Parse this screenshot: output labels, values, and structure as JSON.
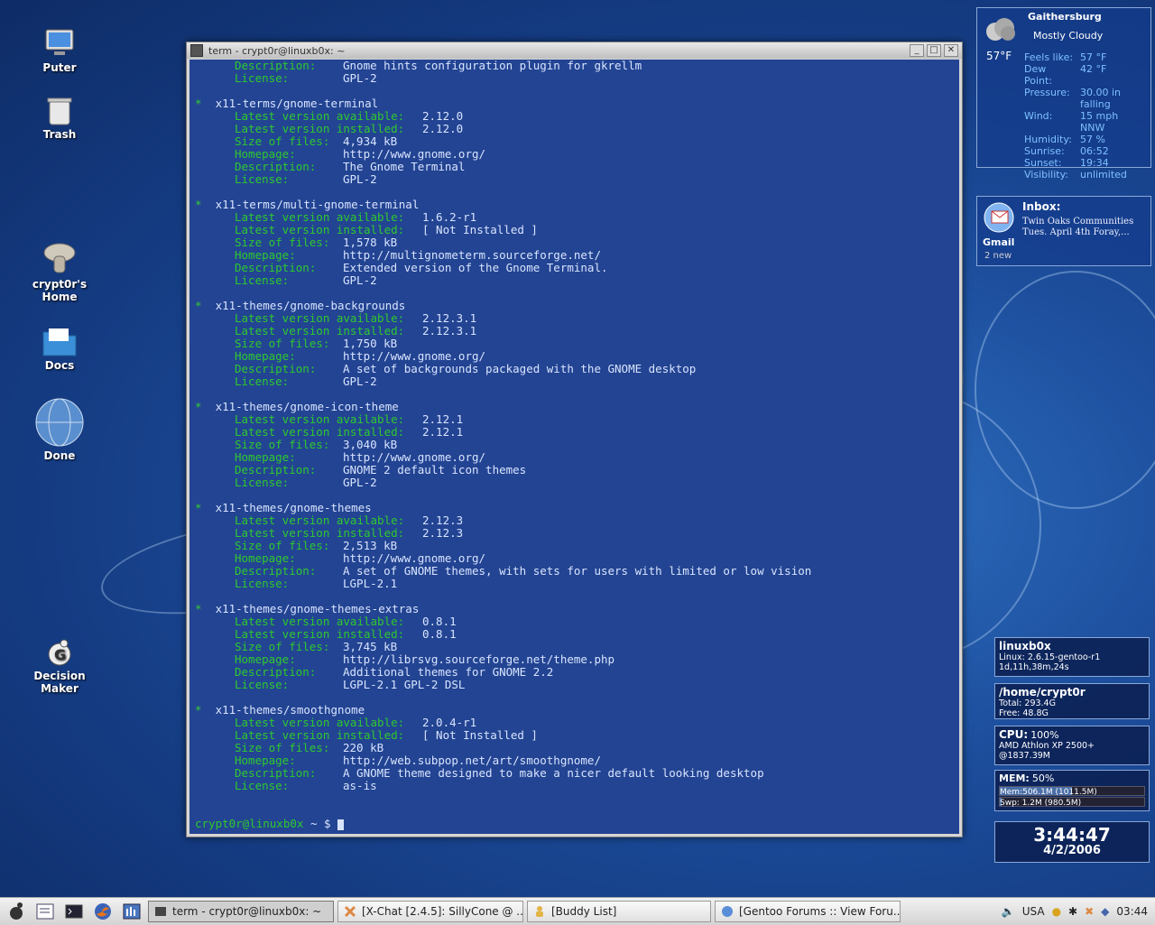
{
  "desktop": {
    "icons": [
      {
        "label": "Puter"
      },
      {
        "label": "Trash"
      },
      {
        "label": "crypt0r's Home"
      },
      {
        "label": "Docs"
      },
      {
        "label": "Done"
      },
      {
        "label": "Decision Maker"
      }
    ]
  },
  "terminal": {
    "title": "term - crypt0r@linuxb0x: ~",
    "top_lines": [
      {
        "key": "Description:",
        "value": "Gnome hints configuration plugin for gkrellm"
      },
      {
        "key": "License:",
        "value": "GPL-2"
      }
    ],
    "packages": [
      {
        "name": "x11-terms/gnome-terminal",
        "latest": "2.12.0",
        "installed": "2.12.0",
        "size": "4,934 kB",
        "homepage": "http://www.gnome.org/",
        "description": "The Gnome Terminal",
        "license": "GPL-2"
      },
      {
        "name": "x11-terms/multi-gnome-terminal",
        "latest": "1.6.2-r1",
        "installed": "[ Not Installed ]",
        "size": "1,578 kB",
        "homepage": "http://multignometerm.sourceforge.net/",
        "description": "Extended version of the Gnome Terminal.",
        "license": "GPL-2"
      },
      {
        "name": "x11-themes/gnome-backgrounds",
        "latest": "2.12.3.1",
        "installed": "2.12.3.1",
        "size": "1,750 kB",
        "homepage": "http://www.gnome.org/",
        "description": "A set of backgrounds packaged with the GNOME desktop",
        "license": "GPL-2"
      },
      {
        "name": "x11-themes/gnome-icon-theme",
        "latest": "2.12.1",
        "installed": "2.12.1",
        "size": "3,040 kB",
        "homepage": "http://www.gnome.org/",
        "description": "GNOME 2 default icon themes",
        "license": "GPL-2"
      },
      {
        "name": "x11-themes/gnome-themes",
        "latest": "2.12.3",
        "installed": "2.12.3",
        "size": "2,513 kB",
        "homepage": "http://www.gnome.org/",
        "description": "A set of GNOME themes, with sets for users with limited or low vision",
        "license": "LGPL-2.1"
      },
      {
        "name": "x11-themes/gnome-themes-extras",
        "latest": "0.8.1",
        "installed": "0.8.1",
        "size": "3,745 kB",
        "homepage": "http://librsvg.sourceforge.net/theme.php",
        "description": "Additional themes for GNOME 2.2",
        "license": "LGPL-2.1 GPL-2 DSL"
      },
      {
        "name": "x11-themes/smoothgnome",
        "latest": "2.0.4-r1",
        "installed": "[ Not Installed ]",
        "size": "220 kB",
        "homepage": "http://web.subpop.net/art/smoothgnome/",
        "description": "A GNOME theme designed to make a nicer default looking desktop",
        "license": "as-is"
      }
    ],
    "labels": {
      "latest": "Latest version available:",
      "installed": "Latest version installed:",
      "size": "Size of files:",
      "homepage": "Homepage:",
      "description": "Description:",
      "license": "License:"
    },
    "prompt": {
      "user": "crypt0r@linuxb0x",
      "path": "~",
      "symbol": "$"
    }
  },
  "weather": {
    "city": "Gaithersburg",
    "condition": "Mostly Cloudy",
    "temp": "57°F",
    "rows": [
      {
        "label": "Feels like:",
        "value": "57 °F"
      },
      {
        "label": "Dew Point:",
        "value": "42 °F"
      },
      {
        "label": "Pressure:",
        "value": "30.00 in falling"
      },
      {
        "label": "Wind:",
        "value": "15 mph NNW"
      },
      {
        "label": "Humidity:",
        "value": "57 %"
      },
      {
        "label": "Sunrise:",
        "value": "06:52"
      },
      {
        "label": "Sunset:",
        "value": "19:34"
      },
      {
        "label": "Visibility:",
        "value": "unlimited"
      }
    ]
  },
  "mail": {
    "inbox": "Inbox:",
    "line1": "Twin Oaks Communities",
    "line2": "Tues. April 4th Foray,...",
    "app": "Gmail",
    "count": "2 new"
  },
  "system": {
    "host": "linuxb0x",
    "kernel": "Linux: 2.6.15-gentoo-r1",
    "uptime": "1d,11h,38m,24s",
    "home_title": "/home/crypt0r",
    "home_total": "Total: 293.4G",
    "home_free": "Free: 48.8G",
    "home_used_fraction": 0.83,
    "cpu_label": "CPU:",
    "cpu_pct": "100%",
    "cpu_fraction": 1.0,
    "cpu_model": "AMD Athlon XP 2500+",
    "cpu_freq": "@1837.39M",
    "mem_label": "MEM:",
    "mem_pct": "50%",
    "mem_line": "Mem:506.1M (1011.5M)",
    "mem_fraction": 0.5,
    "swp_line": "Swp: 1.2M (980.5M)",
    "swp_fraction": 0.01
  },
  "clock": {
    "time": "3:44:47",
    "date": "4/2/2006"
  },
  "taskbar": {
    "tasks": [
      {
        "label": "term - crypt0r@linuxb0x: ~",
        "active": true
      },
      {
        "label": "[X-Chat [2.4.5]: SillyCone @ ..."
      },
      {
        "label": "[Buddy List]"
      },
      {
        "label": "[Gentoo Forums :: View Foru..."
      }
    ],
    "keyboard": "USA",
    "time": "03:44"
  }
}
